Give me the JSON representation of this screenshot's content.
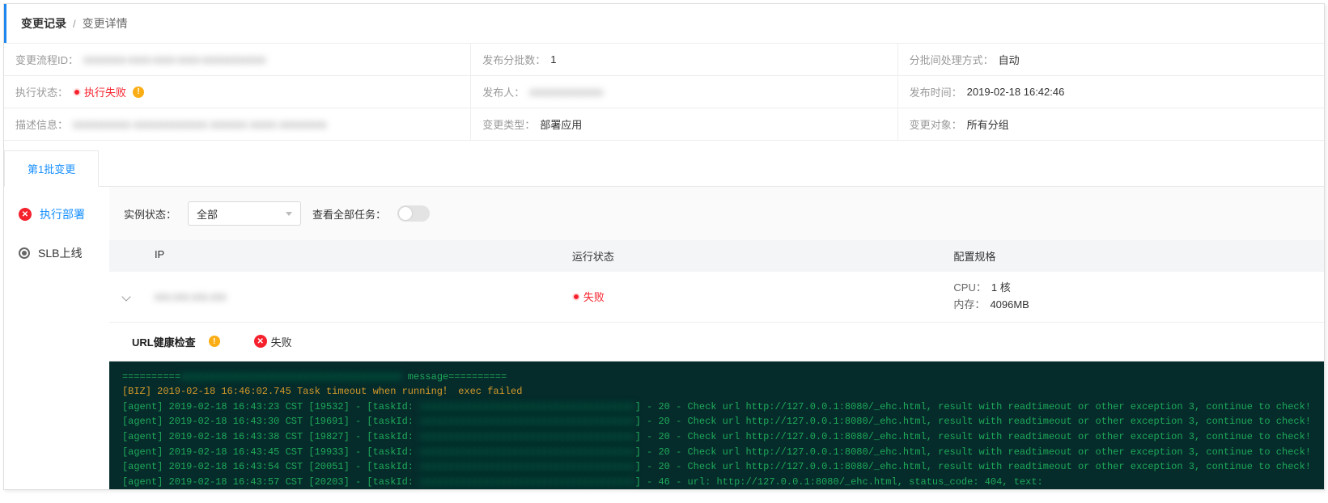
{
  "breadcrumb": {
    "link": "变更记录",
    "sep": "/",
    "current": "变更详情"
  },
  "info": {
    "row1": {
      "c1": {
        "label": "变更流程ID：",
        "value_masked": "xxxxxxxx-xxxx-xxxx-xxxx-xxxxxxxxxxxx"
      },
      "c2": {
        "label": "发布分批数：",
        "value": "1"
      },
      "c3": {
        "label": "分批间处理方式：",
        "value": "自动"
      }
    },
    "row2": {
      "c1": {
        "label": "执行状态：",
        "status": "执行失败"
      },
      "c2": {
        "label": "发布人：",
        "value_masked": "xxxxxxxxxxxxxx"
      },
      "c3": {
        "label": "发布时间：",
        "value": "2019-02-18 16:42:46"
      }
    },
    "row3": {
      "c1": {
        "label": "描述信息：",
        "value_masked": "xxxxxxxxxxx  xxxxxxxxxxxxxx  xxxxxxx  xxxxx  xxxxxxxxx"
      },
      "c2": {
        "label": "变更类型：",
        "value": "部署应用"
      },
      "c3": {
        "label": "变更对象：",
        "value": "所有分组"
      }
    }
  },
  "tabs": {
    "t1": "第1批变更"
  },
  "sidebar": {
    "item1": "执行部署",
    "item2": "SLB上线"
  },
  "filter": {
    "label": "实例状态：",
    "select": "全部",
    "show_all_label": "查看全部任务："
  },
  "table": {
    "head": {
      "ip": "IP",
      "status": "运行状态",
      "spec": "配置规格"
    },
    "row1": {
      "ip_masked": "xxx.xxx.xxx.xxx",
      "status": "失败",
      "spec": {
        "cpu_lbl": "CPU：",
        "cpu": "1 核",
        "mem_lbl": "内存：",
        "mem": "4096MB"
      }
    }
  },
  "health": {
    "title": "URL健康检查",
    "status": "失败"
  },
  "console": {
    "sep_prefix": "==========",
    "sep_mask": "xxxxxxxxxxxxxxxxxxxxxxxxxxxxxxxxxxxxxx",
    "sep_suffix": " message==========",
    "biz": "[BIZ] 2019-02-18 16:46:02.745 Task timeout when running！ exec failed",
    "common_mask": "xxxxxxxxxxxxxxxxxxxxxxxxxxxxxxxxxxxxx",
    "lines": [
      {
        "pre": "[agent] 2019-02-18 16:43:23 CST [19532] - [taskId:",
        "post": "] - 20 - Check url http://127.0.0.1:8080/_ehc.html, result with readtimeout or other exception 3, continue to check!"
      },
      {
        "pre": "[agent] 2019-02-18 16:43:30 CST [19691] - [taskId:",
        "post": "] - 20 - Check url http://127.0.0.1:8080/_ehc.html, result with readtimeout or other exception 3, continue to check!"
      },
      {
        "pre": "[agent] 2019-02-18 16:43:38 CST [19827] - [taskId:",
        "post": "] - 20 - Check url http://127.0.0.1:8080/_ehc.html, result with readtimeout or other exception 3, continue to check!"
      },
      {
        "pre": "[agent] 2019-02-18 16:43:45 CST [19933] - [taskId:",
        "post": "] - 20 - Check url http://127.0.0.1:8080/_ehc.html, result with readtimeout or other exception 3, continue to check!"
      },
      {
        "pre": "[agent] 2019-02-18 16:43:54 CST [20051] - [taskId:",
        "post": "] - 20 - Check url http://127.0.0.1:8080/_ehc.html, result with readtimeout or other exception 3, continue to check!"
      },
      {
        "pre": "[agent] 2019-02-18 16:43:57 CST [20203] - [taskId:",
        "post": "] - 46 - url: http://127.0.0.1:8080/_ehc.html, status_code: 404, text:"
      }
    ]
  }
}
